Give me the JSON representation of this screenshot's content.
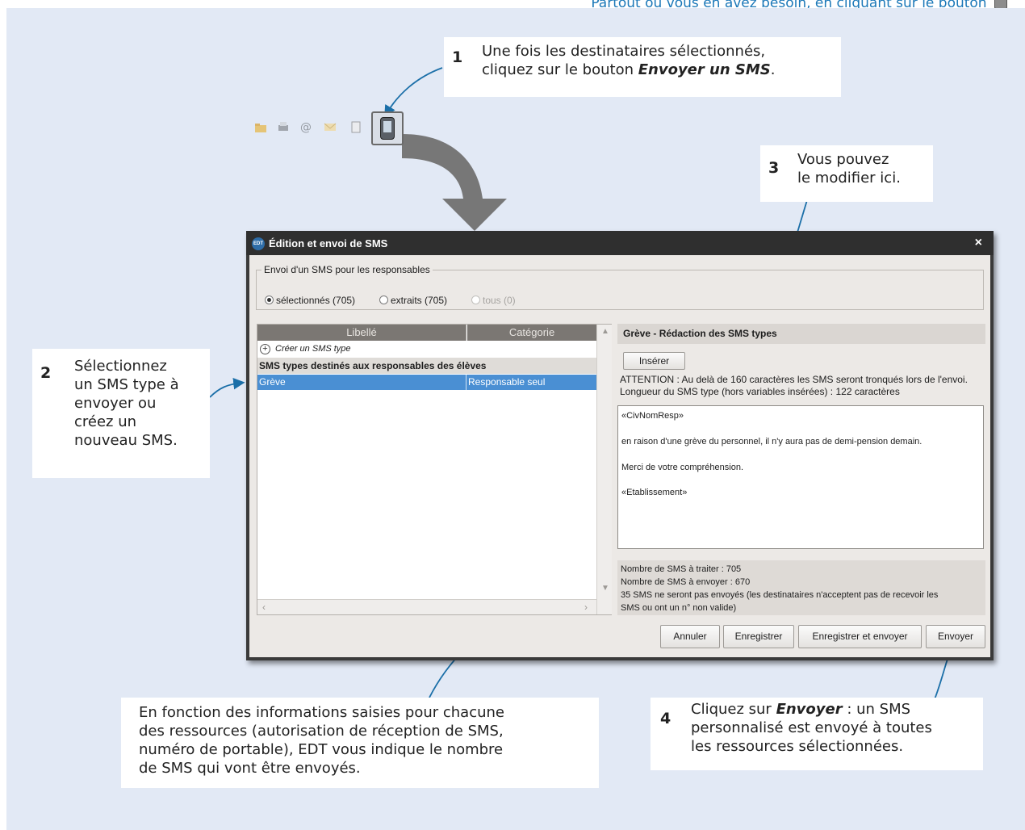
{
  "top_line": {
    "text": "Partout où vous en avez besoin, en cliquant sur le bouton"
  },
  "callouts": {
    "c1": {
      "num": "1",
      "line1": "Une fois les destinataires sélectionnés,",
      "line2_prefix": "cliquez sur le bouton ",
      "line2_bold": "Envoyer un SMS",
      "line2_suffix": "."
    },
    "c2": {
      "num": "2",
      "lines": [
        "Sélectionnez",
        "un SMS type à",
        "envoyer ou",
        "créez un",
        "nouveau SMS."
      ]
    },
    "c3": {
      "num": "3",
      "lines": [
        "Vous pouvez",
        "le modifier ici."
      ]
    },
    "c4": {
      "num": "4",
      "prefix": "Cliquez sur ",
      "bold": "Envoyer",
      "rest1": " : un SMS",
      "line2": "personnalisé est envoyé à toutes",
      "line3": "les ressources sélectionnées."
    },
    "c5": {
      "lines": [
        "En fonction des informations saisies pour chacune",
        "des ressources (autorisation de réception de SMS,",
        "numéro de portable), EDT vous indique le nombre",
        "de SMS qui vont être envoyés."
      ]
    }
  },
  "dialog": {
    "app_icon_text": "EDT",
    "title": "Édition et envoi de SMS",
    "close": "×",
    "envoi_legend": "Envoi d'un SMS pour les responsables",
    "radios": [
      {
        "label": "sélectionnés (705)",
        "checked": true,
        "enabled": true
      },
      {
        "label": "extraits (705)",
        "checked": false,
        "enabled": true
      },
      {
        "label": "tous (0)",
        "checked": false,
        "enabled": false
      }
    ],
    "list": {
      "columns": [
        "Libellé",
        "Catégorie"
      ],
      "create_label": "Créer un SMS type",
      "group": "SMS types destinés aux responsables des élèves",
      "rows": [
        {
          "libelle": "Grève",
          "categorie": "Responsable seul",
          "selected": true
        }
      ]
    },
    "editor": {
      "header": "Grève - Rédaction des SMS types",
      "insert_button": "Insérer",
      "warning": "ATTENTION : Au delà de 160 caractères les SMS seront tronqués lors de l'envoi.",
      "length": "Longueur du SMS type (hors variables insérées) : 122 caractères",
      "message_lines": [
        "«CivNomResp»",
        "en raison d'une grève du personnel, il n'y aura pas de demi-pension demain.",
        "Merci de votre compréhension.",
        "«Etablissement»"
      ]
    },
    "stats": [
      "Nombre de SMS à traiter : 705",
      "Nombre de SMS à envoyer : 670",
      "35 SMS ne seront pas envoyés (les destinataires n'acceptent pas de recevoir les",
      "SMS ou ont un n° non valide)"
    ],
    "buttons": {
      "annuler": "Annuler",
      "enregistrer": "Enregistrer",
      "enregistrer_envoyer": "Enregistrer et envoyer",
      "envoyer": "Envoyer"
    }
  },
  "colors": {
    "panel": "#e2e9f5",
    "accent": "#1b78b8",
    "selection": "#4a8fd3",
    "titlebar": "#2f2f2f"
  }
}
